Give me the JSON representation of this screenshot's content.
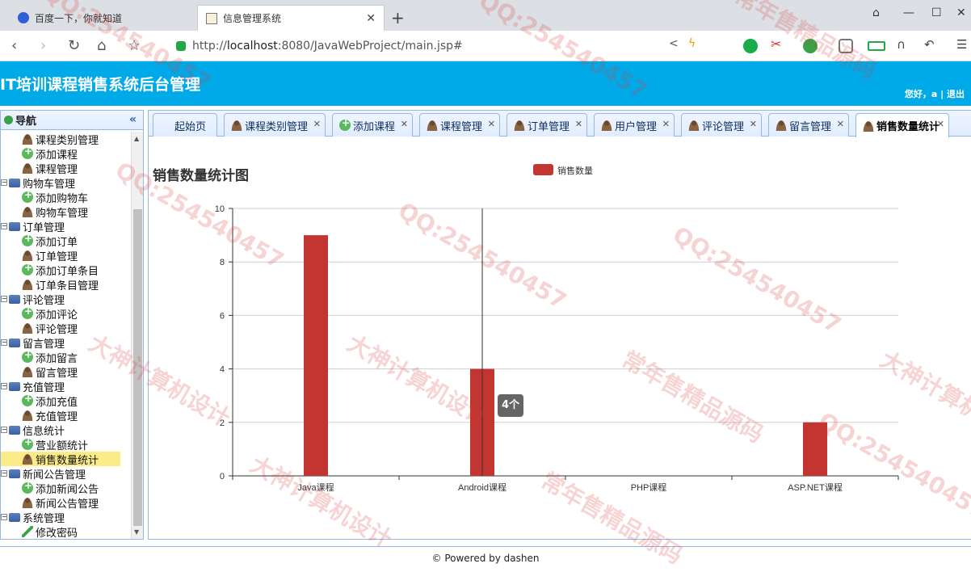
{
  "browser": {
    "tabs": [
      {
        "title": "百度一下，你就知道",
        "active": false
      },
      {
        "title": "信息管理系统",
        "active": true
      }
    ],
    "url_prefix": "http://",
    "url_host": "localhost",
    "url_rest": ":8080/JavaWebProject/main.jsp#"
  },
  "app": {
    "title": "IT培训课程销售系统后台管理",
    "greeting": "您好，a | 退出"
  },
  "sidebar": {
    "header": "导航",
    "items": [
      {
        "type": "leaf",
        "icon": "user",
        "label": "课程类别管理"
      },
      {
        "type": "leaf",
        "icon": "add",
        "label": "添加课程"
      },
      {
        "type": "leaf",
        "icon": "user",
        "label": "课程管理"
      },
      {
        "type": "group",
        "label": "购物车管理"
      },
      {
        "type": "leaf",
        "icon": "add",
        "label": "添加购物车"
      },
      {
        "type": "leaf",
        "icon": "user",
        "label": "购物车管理"
      },
      {
        "type": "group",
        "label": "订单管理"
      },
      {
        "type": "leaf",
        "icon": "add",
        "label": "添加订单"
      },
      {
        "type": "leaf",
        "icon": "user",
        "label": "订单管理"
      },
      {
        "type": "leaf",
        "icon": "add",
        "label": "添加订单条目"
      },
      {
        "type": "leaf",
        "icon": "user",
        "label": "订单条目管理"
      },
      {
        "type": "group",
        "label": "评论管理"
      },
      {
        "type": "leaf",
        "icon": "add",
        "label": "添加评论"
      },
      {
        "type": "leaf",
        "icon": "user",
        "label": "评论管理"
      },
      {
        "type": "group",
        "label": "留言管理"
      },
      {
        "type": "leaf",
        "icon": "add",
        "label": "添加留言"
      },
      {
        "type": "leaf",
        "icon": "user",
        "label": "留言管理"
      },
      {
        "type": "group",
        "label": "充值管理"
      },
      {
        "type": "leaf",
        "icon": "add",
        "label": "添加充值"
      },
      {
        "type": "leaf",
        "icon": "user",
        "label": "充值管理"
      },
      {
        "type": "group",
        "label": "信息统计"
      },
      {
        "type": "leaf",
        "icon": "add",
        "label": "营业额统计"
      },
      {
        "type": "leaf",
        "icon": "user",
        "label": "销售数量统计",
        "selected": true
      },
      {
        "type": "group",
        "label": "新闻公告管理"
      },
      {
        "type": "leaf",
        "icon": "add",
        "label": "添加新闻公告"
      },
      {
        "type": "leaf",
        "icon": "user",
        "label": "新闻公告管理"
      },
      {
        "type": "group",
        "label": "系统管理"
      },
      {
        "type": "leaf",
        "icon": "pen",
        "label": "修改密码"
      }
    ]
  },
  "content_tabs": [
    {
      "label": "起始页",
      "icon": "none",
      "closable": false
    },
    {
      "label": "课程类别管理",
      "icon": "user",
      "closable": true
    },
    {
      "label": "添加课程",
      "icon": "add",
      "closable": true
    },
    {
      "label": "课程管理",
      "icon": "user",
      "closable": true
    },
    {
      "label": "订单管理",
      "icon": "user",
      "closable": true
    },
    {
      "label": "用户管理",
      "icon": "user",
      "closable": true
    },
    {
      "label": "评论管理",
      "icon": "user",
      "closable": true
    },
    {
      "label": "留言管理",
      "icon": "user",
      "closable": true
    },
    {
      "label": "销售数量统计",
      "icon": "user",
      "closable": true,
      "active": true
    }
  ],
  "chart_data": {
    "type": "bar",
    "title": "销售数量统计图",
    "categories": [
      "Java课程",
      "Android课程",
      "PHP课程",
      "ASP.NET课程"
    ],
    "series": [
      {
        "name": "销售数量",
        "values": [
          9,
          4,
          0,
          2
        ]
      }
    ],
    "ylim": [
      0,
      10
    ],
    "yticks": [
      0,
      2,
      4,
      6,
      8,
      10
    ],
    "grid": true,
    "legend": "top-center",
    "bar_color": "#c23531",
    "tooltip": "4个"
  },
  "footer": "© Powered by dashen",
  "watermarks": [
    "QQ:254540457",
    "常年售精品源码",
    "大神计算机设计"
  ]
}
